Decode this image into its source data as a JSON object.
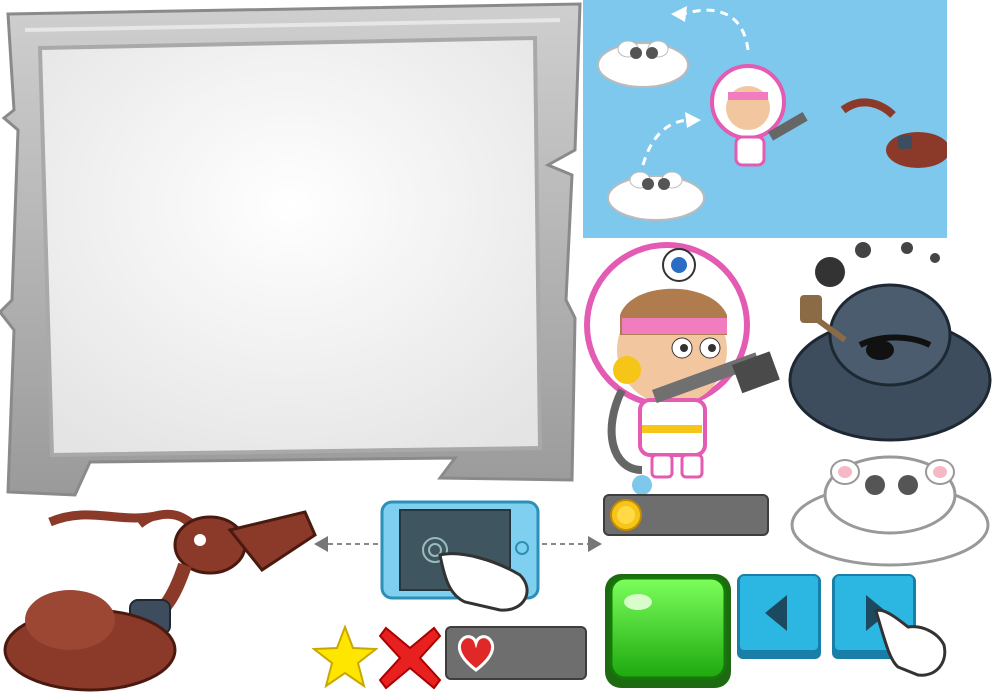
{
  "sheet": {
    "title": "",
    "panel_text": "",
    "coin_counter": {
      "icon": "gold-coin-icon",
      "value": ""
    },
    "lives_counter": {
      "icon": "heart-icon",
      "value": ""
    },
    "buttons": {
      "green": {
        "icon": "green-gem-button"
      },
      "left": {
        "icon": "left-arrow-icon"
      },
      "right": {
        "icon": "right-arrow-icon"
      }
    },
    "icons": [
      "star-icon",
      "red-x-icon",
      "tablet-tap-icon",
      "pointing-hand-icon"
    ],
    "colors": {
      "sky": "#7EC8EE",
      "panel_bg": "#F3F3F3",
      "panel_frame": "#B8B8B8",
      "bar_bg": "#6E6E6E",
      "coin": "#F5C518",
      "heart": "#E02828",
      "green_button": "#3FD82A",
      "arrow_button": "#2CB6E2",
      "star": "#FFE600",
      "x_mark": "#E82020",
      "storm_cloud": "#3E4D5E",
      "smoke_monster": "#8B3A2A"
    }
  }
}
